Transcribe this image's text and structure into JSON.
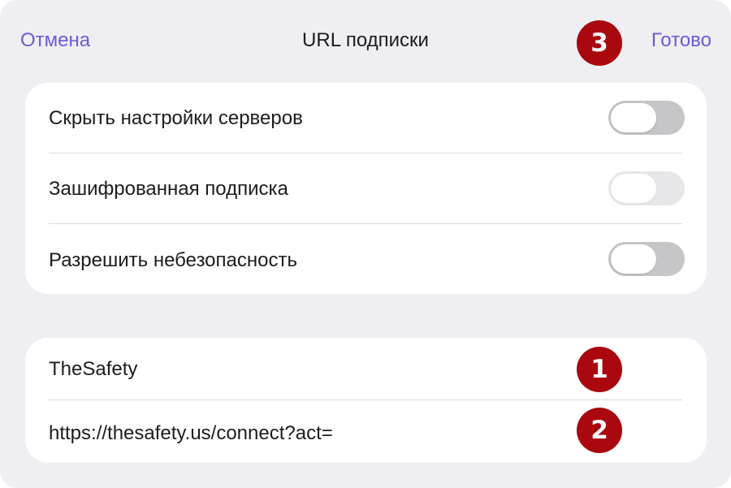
{
  "navbar": {
    "cancel_label": "Отмена",
    "title": "URL подписки",
    "done_label": "Готово"
  },
  "settings": {
    "rows": [
      {
        "label": "Скрыть настройки серверов",
        "toggle": "off",
        "enabled": true
      },
      {
        "label": "Зашифрованная подписка",
        "toggle": "off",
        "enabled": false
      },
      {
        "label": "Разрешить небезопасность",
        "toggle": "off",
        "enabled": true
      }
    ]
  },
  "fields": {
    "name_value": "TheSafety",
    "url_value": "https://thesafety.us/connect?act="
  },
  "markers": {
    "name_marker": "1",
    "url_marker": "2",
    "done_marker": "3"
  },
  "colors": {
    "accent": "#6b5cd6",
    "marker": "#a9080e",
    "background": "#efeef2",
    "card": "#ffffff",
    "toggle_off": "#c6c6c9",
    "toggle_disabled": "#e7e7ea"
  }
}
